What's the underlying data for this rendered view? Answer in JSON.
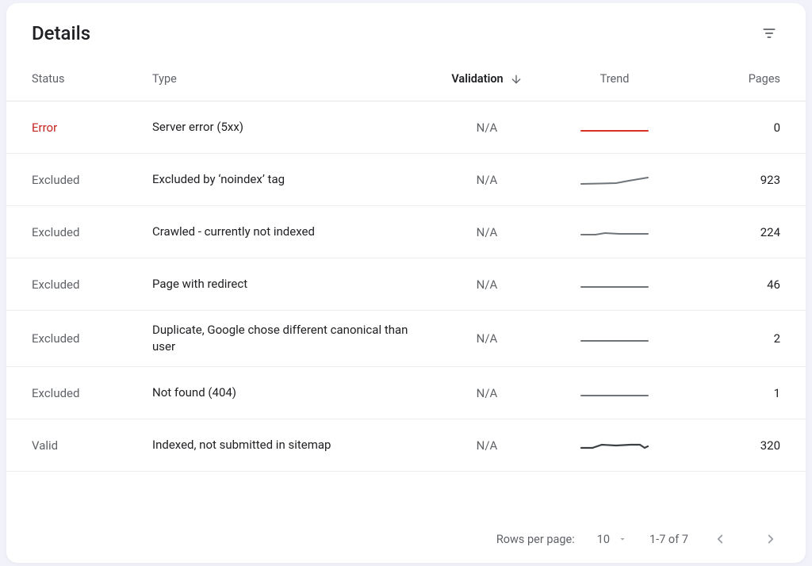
{
  "title": "Details",
  "columns": {
    "status": "Status",
    "type": "Type",
    "validation": "Validation",
    "trend": "Trend",
    "pages": "Pages"
  },
  "rows": [
    {
      "status": "Error",
      "status_style": "error",
      "type": "Server error (5xx)",
      "validation": "N/A",
      "trend": "flat-red",
      "pages": "0"
    },
    {
      "status": "Excluded",
      "status_style": "muted",
      "type": "Excluded by ‘noindex’ tag",
      "validation": "N/A",
      "trend": "rise-grey",
      "pages": "923"
    },
    {
      "status": "Excluded",
      "status_style": "muted",
      "type": "Crawled - currently not indexed",
      "validation": "N/A",
      "trend": "wobble-grey",
      "pages": "224"
    },
    {
      "status": "Excluded",
      "status_style": "muted",
      "type": "Page with redirect",
      "validation": "N/A",
      "trend": "flat-grey",
      "pages": "46"
    },
    {
      "status": "Excluded",
      "status_style": "muted",
      "type": "Duplicate, Google chose different canonical than user",
      "validation": "N/A",
      "trend": "flat-grey",
      "pages": "2"
    },
    {
      "status": "Excluded",
      "status_style": "muted",
      "type": "Not found (404)",
      "validation": "N/A",
      "trend": "flat-grey",
      "pages": "1"
    },
    {
      "status": "Valid",
      "status_style": "muted",
      "type": "Indexed, not submitted in sitemap",
      "validation": "N/A",
      "trend": "wave-dark",
      "pages": "320"
    }
  ],
  "pager": {
    "rows_label": "Rows per page:",
    "rows_value": "10",
    "range": "1-7 of 7"
  }
}
